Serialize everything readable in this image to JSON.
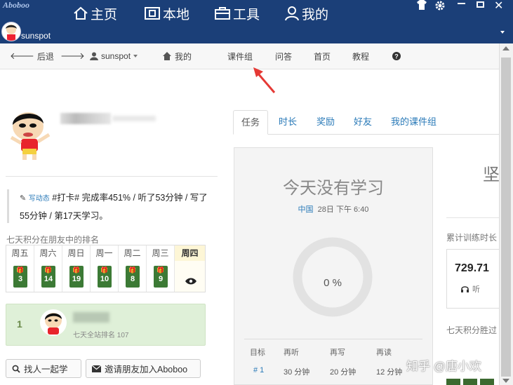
{
  "app": {
    "logo": "Aboboo",
    "username": "sunspot"
  },
  "top_nav": [
    {
      "label": "主页",
      "icon": "home-icon"
    },
    {
      "label": "本地",
      "icon": "local-icon"
    },
    {
      "label": "工具",
      "icon": "toolbox-icon"
    },
    {
      "label": "我的",
      "icon": "user-icon"
    }
  ],
  "toolbar": {
    "back": "后退",
    "user": "sunspot",
    "mine": "我的",
    "group": "课件组",
    "qa": "问答",
    "index": "首页",
    "tutorial": "教程"
  },
  "profile": {
    "write_label": "写动态",
    "status": "#打卡# 完成率451% / 听了53分钟 / 写了55分钟 / 第17天学习。",
    "rank_title": "七天积分在朋友中的排名",
    "days": [
      {
        "name": "周五",
        "value": "3"
      },
      {
        "name": "周六",
        "value": "14"
      },
      {
        "name": "周日",
        "value": "19"
      },
      {
        "name": "周一",
        "value": "10"
      },
      {
        "name": "周二",
        "value": "8"
      },
      {
        "name": "周三",
        "value": "9"
      },
      {
        "name": "周四",
        "value": ""
      }
    ],
    "friend": {
      "rank": "1",
      "site_rank": "七天全站排名 107"
    },
    "find_button": "找人一起学",
    "invite_button": "邀请朋友加入Aboboo"
  },
  "tabs": [
    "任务",
    "时长",
    "奖励",
    "好友",
    "我的课件组"
  ],
  "study": {
    "title": "今天没有学习",
    "location": "中国",
    "datetime": "28日 下午 6:40",
    "progress_label": "0 %",
    "progress_fraction": 0,
    "table_headers": [
      "目标",
      "再听",
      "再写",
      "再读"
    ],
    "table_row": [
      "# 1",
      "30 分钟",
      "20 分钟",
      "12 分钟"
    ]
  },
  "right_panel": {
    "insist": "坚",
    "cumulative_label": "累计训练时长",
    "cumulative_value": "729.71",
    "listen_label": "听",
    "rank7_label": "七天积分胜过"
  },
  "watermark": "知乎 @唐小欢",
  "colors": {
    "title_bar": "#1b3f78",
    "accent": "#2a7ab8",
    "badge_green": "#3c7a35",
    "friend_card": "#dff0d8"
  }
}
